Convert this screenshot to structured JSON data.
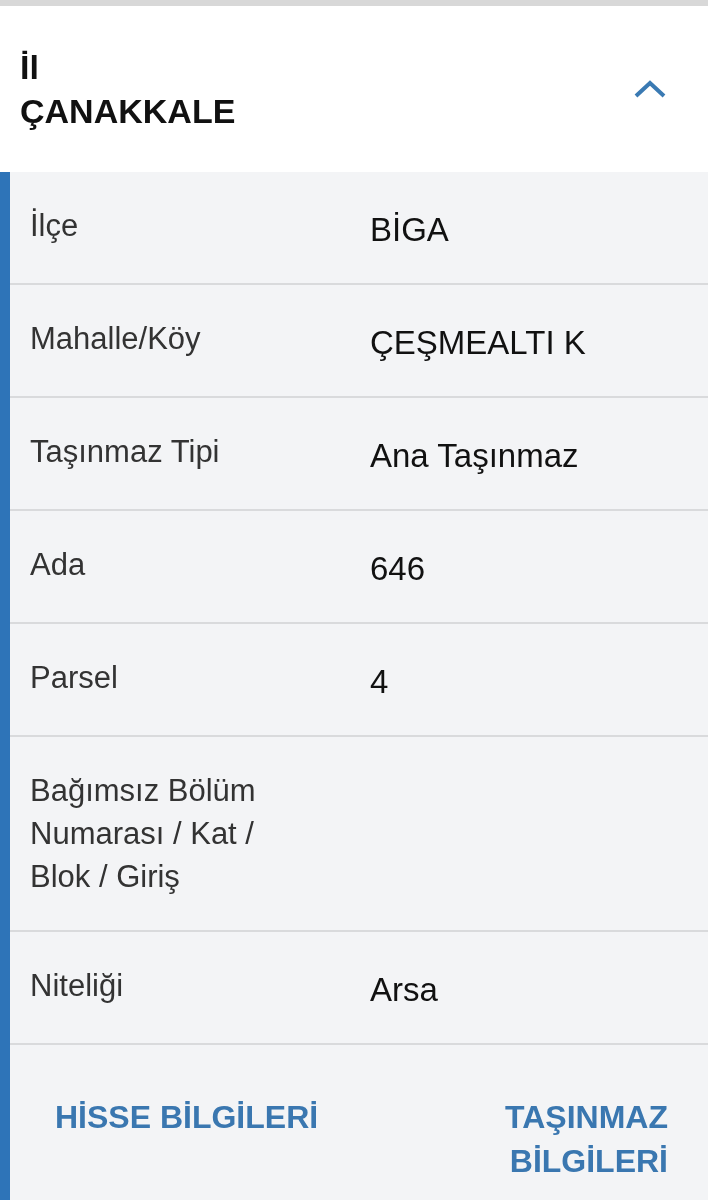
{
  "header": {
    "label": "İl",
    "value": "ÇANAKKALE",
    "expanded": true
  },
  "rows": [
    {
      "label": "İlçe",
      "value": "BİGA"
    },
    {
      "label": "Mahalle/Köy",
      "value": "ÇEŞMEALTI K"
    },
    {
      "label": "Taşınmaz Tipi",
      "value": "Ana Taşınmaz"
    },
    {
      "label": "Ada",
      "value": "646"
    },
    {
      "label": "Parsel",
      "value": "4"
    },
    {
      "label": "Bağımsız Bölüm Numarası / Kat / Blok / Giriş"
    },
    {
      "label": "Niteliği",
      "value": "Arsa"
    }
  ],
  "links": [
    "HİSSE BİLGİLERİ",
    "TAŞINMAZ BİLGİLERİ"
  ]
}
